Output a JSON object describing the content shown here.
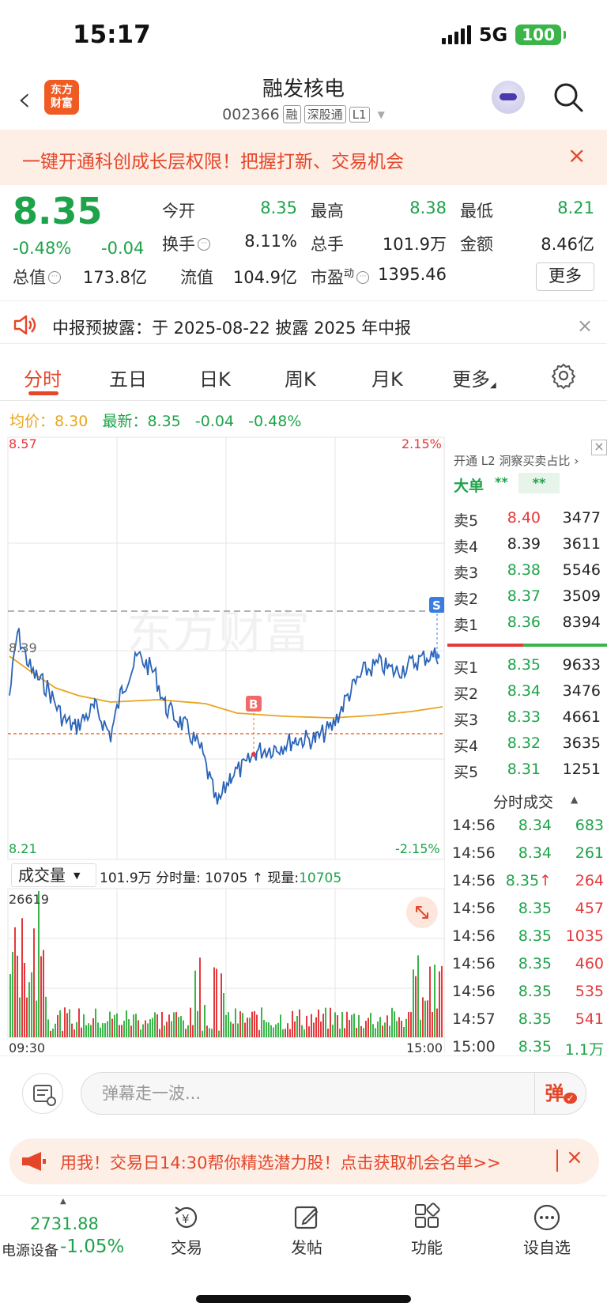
{
  "status": {
    "time": "15:17",
    "network": "5G",
    "battery": "100"
  },
  "header": {
    "logo_line1": "东方",
    "logo_line2": "财富",
    "title": "融发核电",
    "code": "002366",
    "tags": [
      "融",
      "深股通",
      "L1"
    ]
  },
  "promo": {
    "text": "一键开通科创成长层权限！把握打新、交易机会",
    "close": "×"
  },
  "quote": {
    "price": "8.35",
    "change_pct": "-0.48%",
    "change": "-0.04",
    "fields": [
      {
        "label": "今开",
        "value": "8.35",
        "color": "green"
      },
      {
        "label": "最高",
        "value": "8.38",
        "color": "green"
      },
      {
        "label": "最低",
        "value": "8.21",
        "color": "green"
      },
      {
        "label": "换手",
        "value": "8.11%",
        "color": "dark"
      },
      {
        "label": "总手",
        "value": "101.9万",
        "color": "dark"
      },
      {
        "label": "金额",
        "value": "8.46亿",
        "color": "dark"
      },
      {
        "label": "总值",
        "value": "173.8亿",
        "color": "dark"
      },
      {
        "label": "流值",
        "value": "104.9亿",
        "color": "dark"
      },
      {
        "label": "市盈",
        "value": "1395.46",
        "color": "dark",
        "sup": "动"
      }
    ],
    "more": "更多"
  },
  "notice": {
    "text": "中报预披露：于 2025-08-22 披露 2025 年中报",
    "close": "×"
  },
  "tabs": [
    "分时",
    "五日",
    "日K",
    "周K",
    "月K",
    "更多"
  ],
  "avg": {
    "avg_label": "均价：",
    "avg_value": "8.30",
    "last_label": "最新：",
    "last_value": "8.35",
    "chg": "-0.04",
    "pct": "-0.48%"
  },
  "chart_labels": {
    "top_price": "8.57",
    "top_pct": "2.15%",
    "mid_price": "8.39",
    "bot_price": "8.21",
    "bot_pct": "-2.15%",
    "marker_b": "B",
    "marker_s": "S",
    "watermark": "东方财富",
    "vol_max": "26619",
    "time_start": "09:30",
    "time_end": "15:00"
  },
  "volume": {
    "select": "成交量",
    "total": "101.9万",
    "period_label": "分时量:",
    "period_val": "10705",
    "arrow": "↑",
    "now_label": "现量:",
    "now_val": "10705"
  },
  "orderbook": {
    "header": "开通 L2 洞察买卖占比 ›",
    "big_label": "大单",
    "big_v1": "**",
    "big_v2": "**",
    "asks": [
      {
        "label": "卖5",
        "price": "8.40",
        "vol": "3477",
        "color": "#e4393c"
      },
      {
        "label": "卖4",
        "price": "8.39",
        "vol": "3611",
        "color": "#222222"
      },
      {
        "label": "卖3",
        "price": "8.38",
        "vol": "5546",
        "color": "#1fa34a"
      },
      {
        "label": "卖2",
        "price": "8.37",
        "vol": "3509",
        "color": "#1fa34a"
      },
      {
        "label": "卖1",
        "price": "8.36",
        "vol": "8394",
        "color": "#1fa34a"
      }
    ],
    "bids": [
      {
        "label": "买1",
        "price": "8.35",
        "vol": "9633",
        "color": "#1fa34a"
      },
      {
        "label": "买2",
        "price": "8.34",
        "vol": "3476",
        "color": "#1fa34a"
      },
      {
        "label": "买3",
        "price": "8.33",
        "vol": "4661",
        "color": "#1fa34a"
      },
      {
        "label": "买4",
        "price": "8.32",
        "vol": "3635",
        "color": "#1fa34a"
      },
      {
        "label": "买5",
        "price": "8.31",
        "vol": "1251",
        "color": "#1fa34a"
      }
    ],
    "ticks_title": "分时成交",
    "ticks": [
      {
        "time": "14:56",
        "price": "8.34",
        "arrow": "",
        "vol": "683",
        "vcolor": "#1fa34a"
      },
      {
        "time": "14:56",
        "price": "8.34",
        "arrow": "",
        "vol": "261",
        "vcolor": "#1fa34a"
      },
      {
        "time": "14:56",
        "price": "8.35",
        "arrow": "↑",
        "vol": "264",
        "vcolor": "#e4393c"
      },
      {
        "time": "14:56",
        "price": "8.35",
        "arrow": "",
        "vol": "457",
        "vcolor": "#e4393c"
      },
      {
        "time": "14:56",
        "price": "8.35",
        "arrow": "",
        "vol": "1035",
        "vcolor": "#e4393c"
      },
      {
        "time": "14:56",
        "price": "8.35",
        "arrow": "",
        "vol": "460",
        "vcolor": "#e4393c"
      },
      {
        "time": "14:56",
        "price": "8.35",
        "arrow": "",
        "vol": "535",
        "vcolor": "#e4393c"
      },
      {
        "time": "14:57",
        "price": "8.35",
        "arrow": "",
        "vol": "541",
        "vcolor": "#e4393c"
      },
      {
        "time": "15:00",
        "price": "8.35",
        "arrow": "",
        "vol": "1.1万",
        "vcolor": "#1fa34a"
      }
    ]
  },
  "comment": {
    "placeholder": "弹幕走一波...",
    "dan": "弹"
  },
  "banner": {
    "text": "用我！交易日14:30帮你精选潜力股！点击获取机会名单>>",
    "close": "×"
  },
  "bottom_nav": {
    "index_value": "2731.88",
    "index_name": "电源设备",
    "index_chg": "-1.05%",
    "items": [
      "交易",
      "发帖",
      "功能",
      "设自选"
    ]
  },
  "colors": {
    "accent": "#e4462a",
    "up": "#e4393c",
    "down": "#1fa34a",
    "avg_line": "#e8a51e",
    "price_line": "#2b64b8"
  }
}
